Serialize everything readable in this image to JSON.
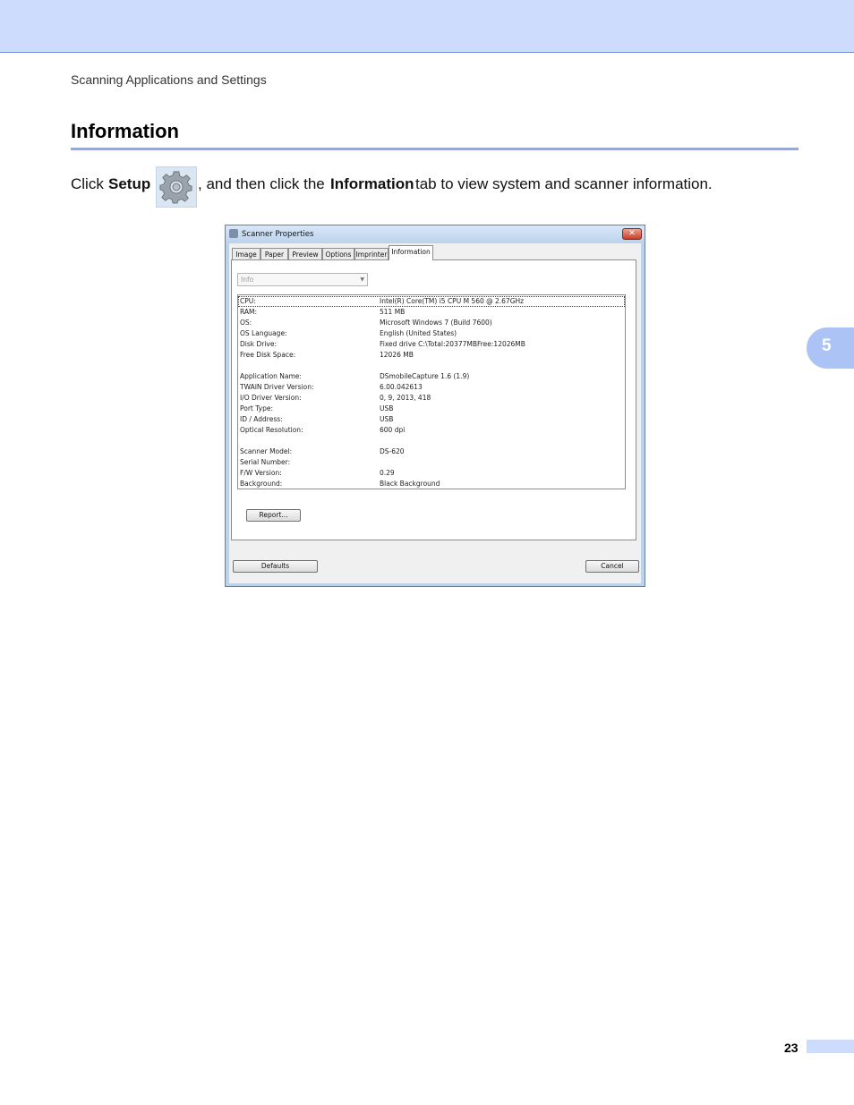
{
  "header": {
    "breadcrumb": "Scanning Applications and Settings",
    "title": "Information"
  },
  "instruction": {
    "part1": "Click ",
    "setup": "Setup",
    "part2": ", and then click the ",
    "information": "Information",
    "part3": " tab to view system and scanner information."
  },
  "chapter_tab": "5",
  "page_number": "23",
  "dialog": {
    "title": "Scanner Properties",
    "close_symbol": "✕",
    "tabs": [
      {
        "label": "Image"
      },
      {
        "label": "Paper"
      },
      {
        "label": "Preview"
      },
      {
        "label": "Options"
      },
      {
        "label": "Imprinter"
      },
      {
        "label": "Information"
      }
    ],
    "active_tab": "Information",
    "combo_value": "Info",
    "combo_arrow": "▼",
    "rows": [
      {
        "key": "CPU:",
        "value": "Intel(R) Core(TM) i5 CPU       M 560  @ 2.67GHz"
      },
      {
        "key": "RAM:",
        "value": "511 MB"
      },
      {
        "key": "OS:",
        "value": "Microsoft Windows 7  (Build 7600)"
      },
      {
        "key": "OS Language:",
        "value": "English (United States)"
      },
      {
        "key": "Disk Drive:",
        "value": "Fixed drive C:\\Total:20377MBFree:12026MB"
      },
      {
        "key": "Free Disk Space:",
        "value": "12026 MB"
      },
      {
        "key": "Application Name:",
        "value": " DSmobileCapture 1.6 (1.9)"
      },
      {
        "key": "TWAIN Driver Version:",
        "value": "6.00.042613"
      },
      {
        "key": "I/O Driver Version:",
        "value": "0, 9, 2013, 418"
      },
      {
        "key": "Port Type:",
        "value": "USB"
      },
      {
        "key": "ID / Address:",
        "value": "USB"
      },
      {
        "key": "Optical Resolution:",
        "value": "600 dpi"
      },
      {
        "key": "Scanner Model:",
        "value": "DS-620"
      },
      {
        "key": "Serial Number:",
        "value": ""
      },
      {
        "key": "F/W Version:",
        "value": "0.29"
      },
      {
        "key": "Background:",
        "value": "Black Background"
      }
    ],
    "report_button": "Report...",
    "defaults_button": "Defaults",
    "cancel_button": "Cancel"
  }
}
